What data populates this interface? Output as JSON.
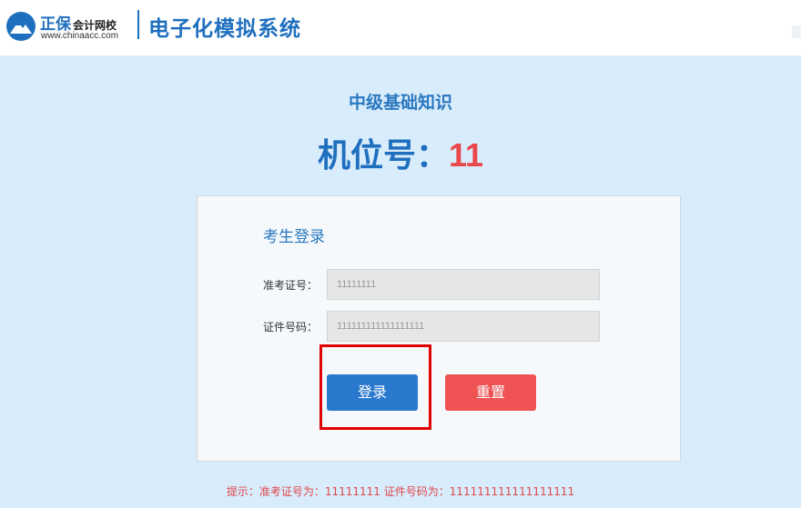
{
  "header": {
    "brand_name": "正保",
    "brand_sub": "会计网校",
    "brand_url": "www.chinaacc.com",
    "system_title": "电子化模拟系统",
    "logo_icon": "mountain-logo-icon"
  },
  "exam": {
    "subject": "中级基础知识",
    "seat_label": "机位号：",
    "seat_number": "11"
  },
  "login": {
    "title": "考生登录",
    "admission_label": "准考证号：",
    "admission_value": "11111111",
    "id_label": "证件号码：",
    "id_value": "111111111111111111",
    "login_button": "登录",
    "reset_button": "重置"
  },
  "hint": "提示：准考证号为：11111111 证件号码为：111111111111111111",
  "colors": {
    "accent": "#1f6fbf",
    "background": "#d9ecfb",
    "seat_number": "#e8474b",
    "login_button": "#2b78cf",
    "reset_button": "#ee5253",
    "highlight": "#e00000"
  }
}
